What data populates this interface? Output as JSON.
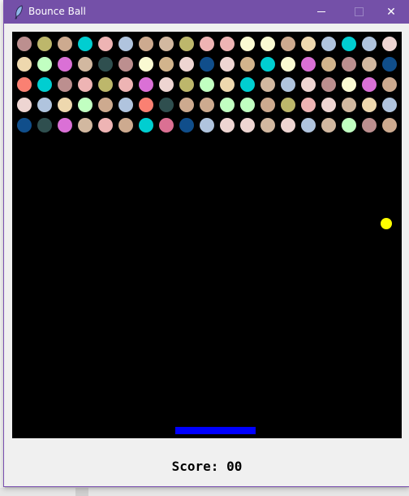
{
  "window": {
    "title": "Bounce Ball",
    "icon": "feather-icon",
    "controls": {
      "minimize": "minimize-icon",
      "maximize": "maximize-icon",
      "close_label": "✕"
    }
  },
  "game": {
    "score_label": "Score: 00",
    "colors": {
      "background": "#000000",
      "paddle": "#0000ff",
      "ball": "#ffff00"
    },
    "brick_rows": [
      [
        "#bc8f8f",
        "#bdb76b",
        "#cdaa8f",
        "#00ced1",
        "#eeb4b4",
        "#b0c4de",
        "#cdaa8f",
        "#d2b8a0",
        "#bdb76b",
        "#eeb4b4",
        "#eeb4b4",
        "#fafad2",
        "#fafad2",
        "#cdaa8f",
        "#eed8ae",
        "#b0c4de",
        "#00ced1",
        "#b0c4de",
        "#eed5d2"
      ],
      [
        "#eed8ae",
        "#c1ffc1",
        "#da70d6",
        "#d2b8a0",
        "#2f4f4f",
        "#bc8f8f",
        "#fafad2",
        "#d2b48c",
        "#eed5d2",
        "#104e8b",
        "#eed5d2",
        "#d2b48c",
        "#00ced1",
        "#fafad2",
        "#da70d6",
        "#d2b48c",
        "#bc8f8f",
        "#d2b8a0",
        "#104e8b"
      ],
      [
        "#fa8072",
        "#00ced1",
        "#bc8f8f",
        "#eeb4b4",
        "#bdb76b",
        "#eeb4b4",
        "#da70d6",
        "#eed5d2",
        "#bdb76b",
        "#c1ffc1",
        "#eed8ae",
        "#00ced1",
        "#d2b8a0",
        "#b0c4de",
        "#eed5d2",
        "#bc8f8f",
        "#fafad2",
        "#da70d6",
        "#cdaa8f"
      ],
      [
        "#eed5d2",
        "#b0c4de",
        "#eed8ae",
        "#c1ffc1",
        "#cdaa8f",
        "#b0c4de",
        "#fa8072",
        "#2f4f4f",
        "#cdaa8f",
        "#cdaa8f",
        "#c1ffc1",
        "#c1ffc1",
        "#cdaa8f",
        "#bdb76b",
        "#eeb4b4",
        "#eed5d2",
        "#d2b8a0",
        "#eed8ae",
        "#b0c4de"
      ],
      [
        "#104e8b",
        "#2f4f4f",
        "#da70d6",
        "#d2b8a0",
        "#eeb4b4",
        "#cdaa8f",
        "#00ced1",
        "#db7093",
        "#104e8b",
        "#b0c4de",
        "#eed5d2",
        "#eed5d2",
        "#d2b8a0",
        "#eed5d2",
        "#b0c4de",
        "#d2b8a0",
        "#c1ffc1",
        "#bc8f8f",
        "#cdaa8f"
      ]
    ]
  }
}
